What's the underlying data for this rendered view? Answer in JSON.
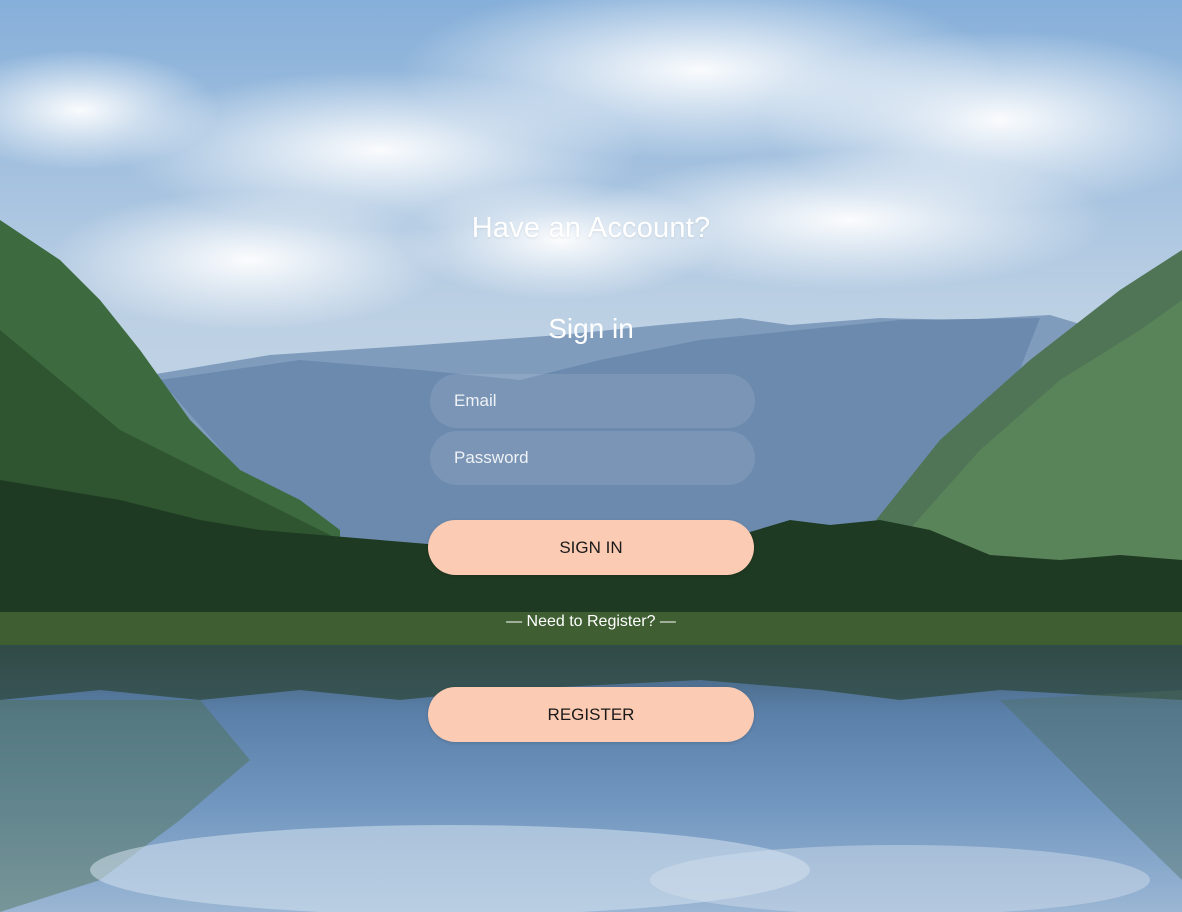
{
  "header": {
    "title": "Have an Account?"
  },
  "form": {
    "heading": "Sign in",
    "email_placeholder": "Email",
    "password_placeholder": "Password",
    "email_value": "",
    "password_value": "",
    "signin_label": "SIGN IN"
  },
  "register": {
    "prompt": "— Need to Register? —",
    "button_label": "REGISTER"
  },
  "colors": {
    "button_bg": "#fbcbb3",
    "text": "#ffffff"
  }
}
